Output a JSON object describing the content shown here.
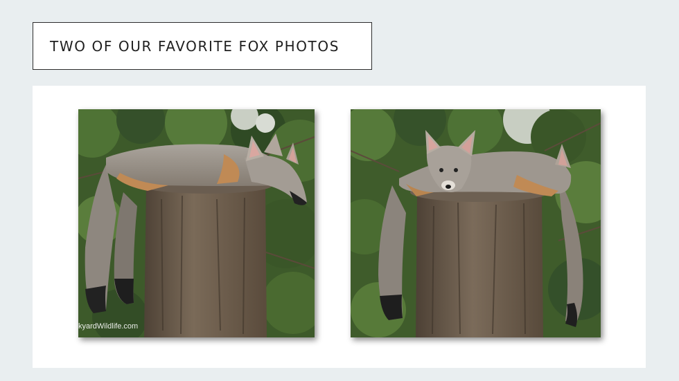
{
  "header": {
    "title": "TWO OF OUR FAVORITE FOX PHOTOS"
  },
  "gallery": {
    "photos": [
      {
        "subject": "gray fox lying on tree stump, head resting",
        "watermark": "kyardWildlife.com"
      },
      {
        "subject": "gray fox lying on tree stump, facing camera"
      }
    ]
  },
  "colors": {
    "background": "#e9eef0",
    "panel": "#ffffff",
    "title_border": "#2b2b2b",
    "title_text": "#1f1f1f",
    "foliage": "#3d5a2a",
    "stump": "#6b5a48",
    "fox_gray": "#9a948e",
    "fox_orange": "#c08a55"
  }
}
